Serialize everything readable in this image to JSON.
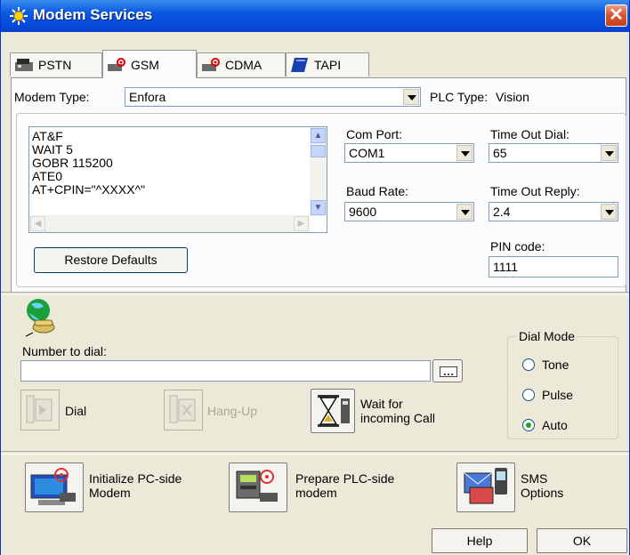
{
  "window": {
    "title": "Modem Services"
  },
  "tabs": [
    {
      "label": "PSTN",
      "icon": "pstn-modem-icon"
    },
    {
      "label": "GSM",
      "icon": "gsm-modem-icon",
      "active": true
    },
    {
      "label": "CDMA",
      "icon": "cdma-modem-icon"
    },
    {
      "label": "TAPI",
      "icon": "tapi-book-icon"
    }
  ],
  "modem": {
    "type_label": "Modem Type:",
    "type_value": "Enfora",
    "plc_type_label": "PLC Type:",
    "plc_type_value": "Vision",
    "init_lines": [
      "AT&F",
      "WAIT 5",
      "GOBR 115200",
      "ATE0",
      "AT+CPIN=\"^XXXX^\""
    ],
    "com_port_label": "Com Port:",
    "com_port_value": "COM1",
    "baud_rate_label": "Baud Rate:",
    "baud_rate_value": "9600",
    "timeout_dial_label": "Time Out Dial:",
    "timeout_dial_value": "65",
    "timeout_reply_label": "Time Out Reply:",
    "timeout_reply_value": "2.4",
    "pin_label": "PIN code:",
    "pin_value": "1111",
    "restore_label": "Restore Defaults"
  },
  "dial": {
    "number_label": "Number to dial:",
    "number_value": "",
    "dial_label": "Dial",
    "hangup_label": "Hang-Up",
    "wait_line1": "Wait for",
    "wait_line2": "incoming Call",
    "mode_title": "Dial Mode",
    "modes": [
      {
        "label": "Tone",
        "selected": false
      },
      {
        "label": "Pulse",
        "selected": false
      },
      {
        "label": "Auto",
        "selected": true
      }
    ]
  },
  "actions": {
    "init_pc_line1": "Initialize PC-side",
    "init_pc_line2": "Modem",
    "prepare_plc_line1": "Prepare PLC-side",
    "prepare_plc_line2": "modem",
    "sms_line1": "SMS",
    "sms_line2": "Options"
  },
  "footer": {
    "help_label": "Help",
    "ok_label": "OK"
  }
}
